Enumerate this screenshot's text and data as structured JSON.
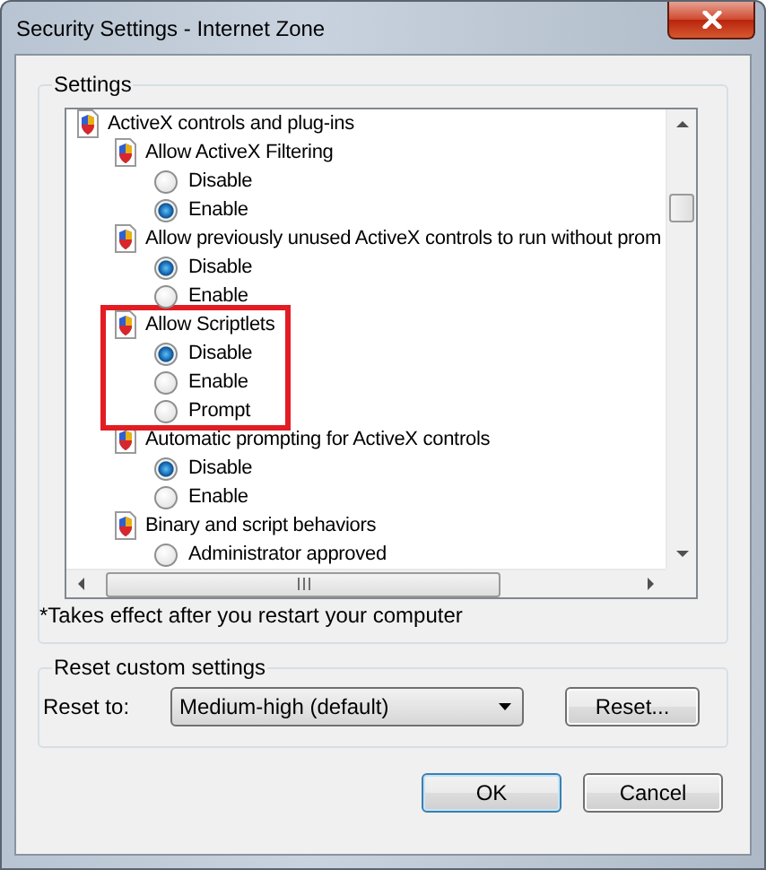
{
  "window": {
    "title": "Security Settings - Internet Zone"
  },
  "settings": {
    "title": "Settings",
    "tree": [
      {
        "label": "ActiveX controls and plug-ins",
        "children": [
          {
            "label": "Allow ActiveX Filtering",
            "highlighted": false,
            "options": [
              {
                "label": "Disable",
                "selected": false
              },
              {
                "label": "Enable",
                "selected": true
              }
            ]
          },
          {
            "label": "Allow previously unused ActiveX controls to run without prom",
            "highlighted": false,
            "options": [
              {
                "label": "Disable",
                "selected": true
              },
              {
                "label": "Enable",
                "selected": false
              }
            ]
          },
          {
            "label": "Allow Scriptlets",
            "highlighted": true,
            "options": [
              {
                "label": "Disable",
                "selected": true
              },
              {
                "label": "Enable",
                "selected": false
              },
              {
                "label": "Prompt",
                "selected": false
              }
            ]
          },
          {
            "label": "Automatic prompting for ActiveX controls",
            "highlighted": false,
            "options": [
              {
                "label": "Disable",
                "selected": true
              },
              {
                "label": "Enable",
                "selected": false
              }
            ]
          },
          {
            "label": "Binary and script behaviors",
            "highlighted": false,
            "options": [
              {
                "label": "Administrator approved",
                "selected": false
              }
            ]
          }
        ]
      }
    ],
    "footnote": "*Takes effect after you restart your computer"
  },
  "reset": {
    "title": "Reset custom settings",
    "label": "Reset to:",
    "dropdown": {
      "value": "Medium-high (default)"
    },
    "button": "Reset..."
  },
  "buttons": [
    {
      "label": "OK",
      "default": true
    },
    {
      "label": "Cancel",
      "default": false
    }
  ]
}
